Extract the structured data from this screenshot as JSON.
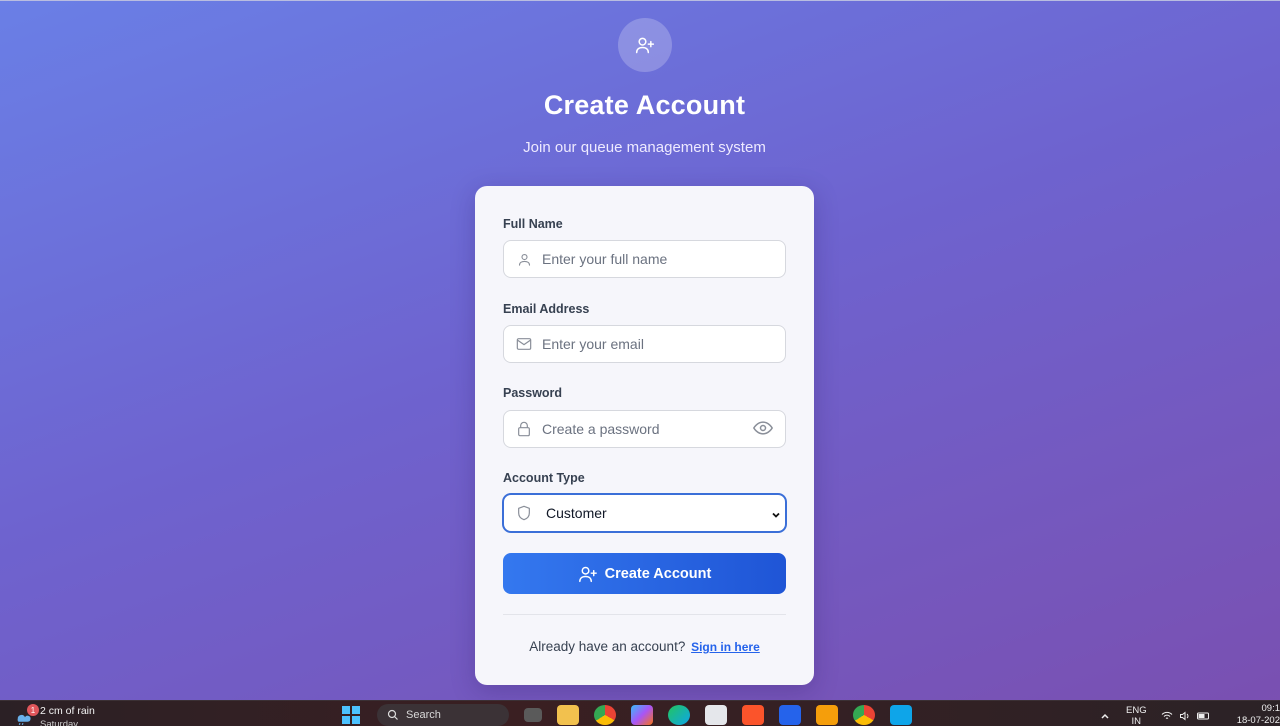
{
  "header": {
    "icon": "user-plus-icon",
    "title": "Create Account",
    "subtitle": "Join our queue management system"
  },
  "form": {
    "full_name": {
      "label": "Full Name",
      "placeholder": "Enter your full name",
      "icon": "user-icon"
    },
    "email": {
      "label": "Email Address",
      "placeholder": "Enter your email",
      "icon": "mail-icon"
    },
    "password": {
      "label": "Password",
      "placeholder": "Create a password",
      "icon": "lock-icon",
      "toggle_icon": "eye-icon"
    },
    "account_type": {
      "label": "Account Type",
      "selected": "Customer",
      "icon": "shield-icon"
    },
    "submit_label": "Create Account",
    "signin_prompt": "Already have an account?",
    "signin_link": "Sign in here"
  },
  "colors": {
    "accent": "#2563eb",
    "button_start": "#3478ef",
    "button_end": "#1f55d6",
    "bg_start": "#6a7fe6",
    "bg_end": "#7a4fb0"
  },
  "taskbar": {
    "weather_badge": "1",
    "weather_text": "2 cm of rain",
    "weather_sub": "Saturday",
    "search_label": "Search",
    "lang_top": "ENG",
    "lang_bottom": "IN",
    "time": "09:1",
    "date": "18-07-202"
  }
}
